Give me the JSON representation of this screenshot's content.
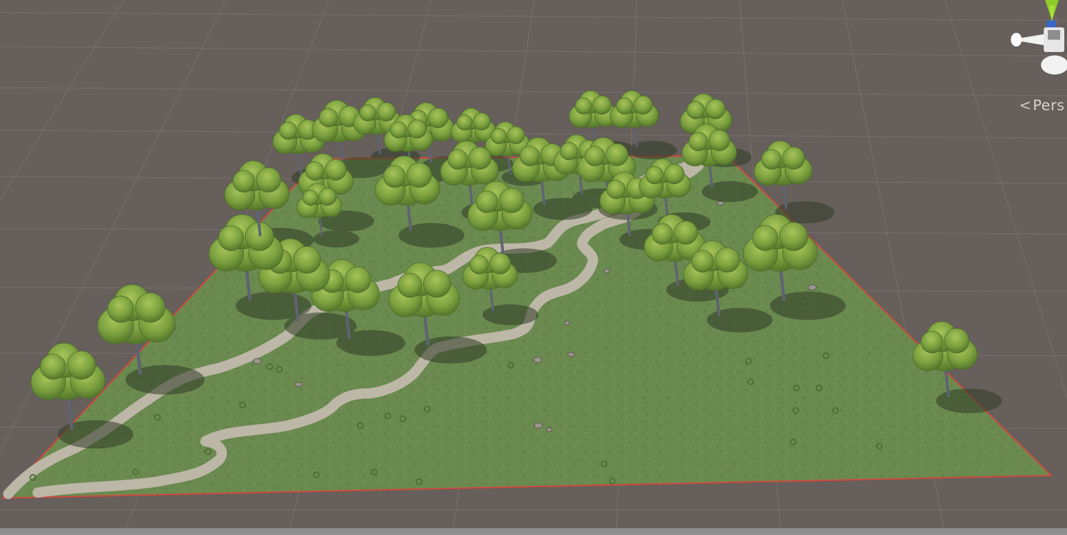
{
  "scene_view": {
    "projection_label": "Pers",
    "projection_chevron": "<",
    "gizmo_icon": "scene-orientation-gizmo-icon"
  },
  "colors": {
    "background": "#665f5b",
    "grid_line": "#7a736f",
    "terrain": "#6a8a4f",
    "terrain_border": "#d2483c",
    "path": "#bdb7a7",
    "foliage": "#7da33f",
    "trunk": "#5e6372",
    "gizmo_y": "#8ccb2a"
  }
}
